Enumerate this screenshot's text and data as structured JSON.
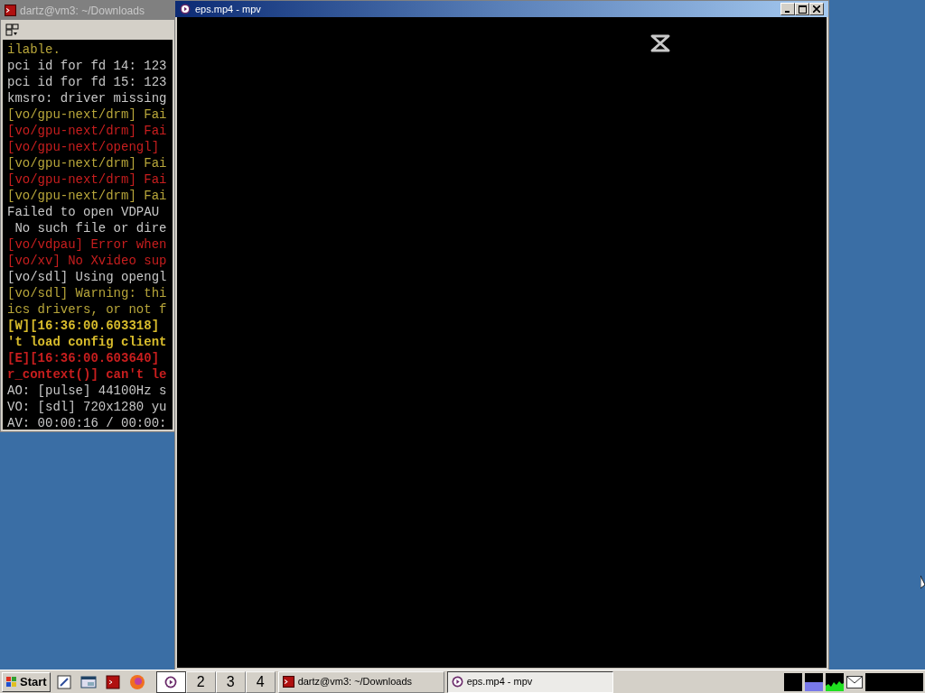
{
  "terminal": {
    "title": "dartz@vm3: ~/Downloads",
    "lines": [
      {
        "text": "ilable.",
        "kind": "warn"
      },
      {
        "text": "pci id for fd 14: 123",
        "kind": "info"
      },
      {
        "text": "pci id for fd 15: 123",
        "kind": "info"
      },
      {
        "text": "kmsro: driver missing",
        "kind": "info"
      },
      {
        "text": "[vo/gpu-next/drm] Fai",
        "kind": "warn"
      },
      {
        "text": "[vo/gpu-next/drm] Fai",
        "kind": "error"
      },
      {
        "text": "[vo/gpu-next/opengl]",
        "kind": "error"
      },
      {
        "text": "[vo/gpu-next/drm] Fai",
        "kind": "warn"
      },
      {
        "text": "[vo/gpu-next/drm] Fai",
        "kind": "error"
      },
      {
        "text": "[vo/gpu-next/drm] Fai",
        "kind": "warn"
      },
      {
        "text": "Failed to open VDPAU",
        "kind": "info"
      },
      {
        "text": " No such file or dire",
        "kind": "info"
      },
      {
        "text": "[vo/vdpau] Error when",
        "kind": "error"
      },
      {
        "text": "[vo/xv] No Xvideo sup",
        "kind": "error"
      },
      {
        "text": "[vo/sdl] Using opengl",
        "kind": "info"
      },
      {
        "text": "[vo/sdl] Warning: thi",
        "kind": "warn"
      },
      {
        "text": "ics drivers, or not f",
        "kind": "warn"
      },
      {
        "text": "[W][16:36:00.603318]",
        "kind": "bold-warn"
      },
      {
        "text": "'t load config client",
        "kind": "bold-warn"
      },
      {
        "text": "[E][16:36:00.603640]",
        "kind": "bold-error"
      },
      {
        "text": "r_context()] can't le",
        "kind": "bold-error"
      },
      {
        "text": "AO: [pulse] 44100Hz s",
        "kind": "info"
      },
      {
        "text": "VO: [sdl] 720x1280 yu",
        "kind": "info"
      },
      {
        "text": "AV: 00:00:16 / 00:00:",
        "kind": "info"
      }
    ]
  },
  "player": {
    "title": "eps.mp4 - mpv"
  },
  "taskbar": {
    "start": "Start",
    "desktops": [
      {
        "selected": true
      },
      {
        "label": "2",
        "selected": false
      },
      {
        "label": "3",
        "selected": false
      },
      {
        "label": "4",
        "selected": false
      }
    ],
    "tasks": [
      {
        "label": "dartz@vm3: ~/Downloads",
        "kind": "terminal",
        "selected": false
      },
      {
        "label": "eps.mp4 - mpv",
        "kind": "mpv",
        "selected": true
      }
    ]
  }
}
